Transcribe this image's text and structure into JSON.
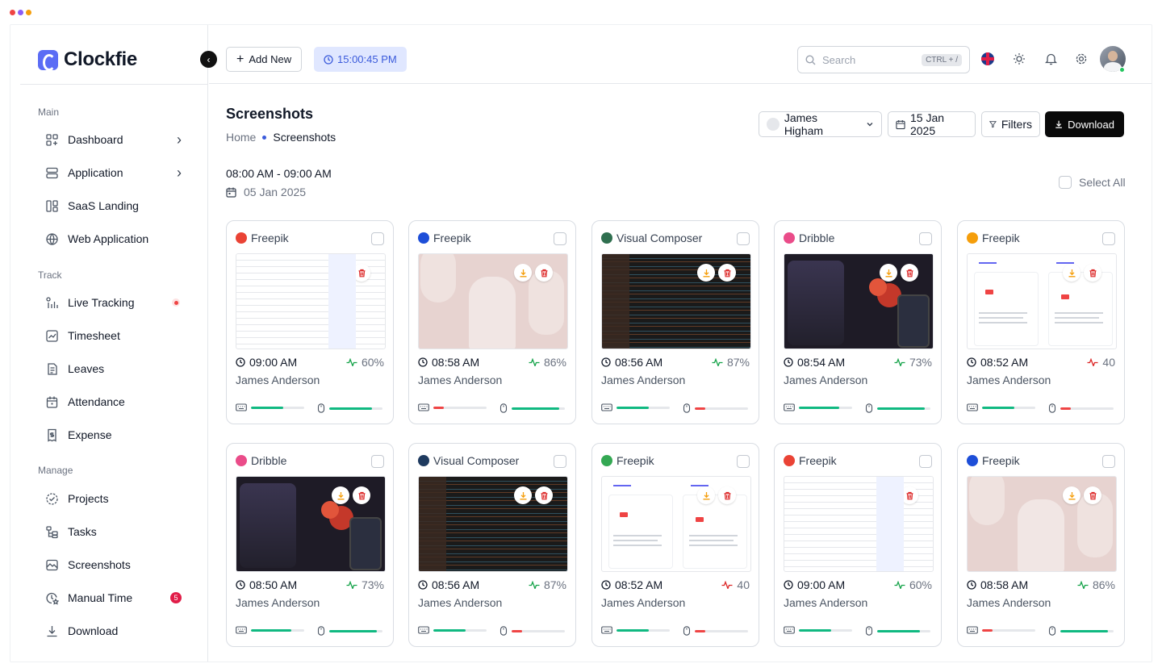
{
  "window_dots": [
    "#ef4444",
    "#8b5cf6",
    "#f59e0b"
  ],
  "brand": {
    "name": "Clockfie",
    "accent": "#5b6cf5"
  },
  "sidebar": {
    "sections": [
      {
        "label": "Main",
        "items": [
          {
            "label": "Dashboard",
            "icon": "grid-icon",
            "chevron": true
          },
          {
            "label": "Application",
            "icon": "layers-icon",
            "chevron": true
          },
          {
            "label": "SaaS Landing",
            "icon": "layout-icon"
          },
          {
            "label": "Web Application",
            "icon": "globe-icon"
          }
        ]
      },
      {
        "label": "Track",
        "items": [
          {
            "label": "Live Tracking",
            "icon": "signal-icon",
            "live": true
          },
          {
            "label": "Timesheet",
            "icon": "chart-icon"
          },
          {
            "label": "Leaves",
            "icon": "document-icon"
          },
          {
            "label": "Attendance",
            "icon": "calendar-icon"
          },
          {
            "label": "Expense",
            "icon": "receipt-icon"
          }
        ]
      },
      {
        "label": "Manage",
        "items": [
          {
            "label": "Projects",
            "icon": "check-circle-icon"
          },
          {
            "label": "Tasks",
            "icon": "tasks-icon"
          },
          {
            "label": "Screenshots",
            "icon": "image-icon"
          },
          {
            "label": "Manual Time",
            "icon": "clock-star-icon",
            "badge": "5"
          },
          {
            "label": "Download",
            "icon": "download-icon"
          }
        ]
      }
    ]
  },
  "header": {
    "add_new": "Add New",
    "clock": "15:00:45 PM",
    "search": {
      "placeholder": "Search",
      "shortcut": "CTRL + /"
    }
  },
  "page": {
    "title": "Screenshots",
    "breadcrumb": {
      "home": "Home",
      "current": "Screenshots"
    },
    "user_filter": "James Higham",
    "date_filter": "15 Jan 2025",
    "filters": "Filters",
    "download": "Download",
    "time_range": "08:00 AM - 09:00 AM",
    "date": "05 Jan 2025",
    "select_all": "Select All"
  },
  "colors": {
    "good": "#16a34a",
    "bad": "#dc2626",
    "bar_good": "#10b981",
    "bar_bad": "#ef4444"
  },
  "cards": [
    {
      "app": "Freepik",
      "app_color": "#ea4335",
      "thumb": "mail",
      "time": "09:00 AM",
      "activity": "60%",
      "good": true,
      "user": "James Anderson",
      "keyboard": 0.6,
      "mouse": 0.8
    },
    {
      "app": "Freepik",
      "app_color": "#1d4ed8",
      "thumb": "hoodie",
      "time": "08:58 AM",
      "activity": "86%",
      "good": true,
      "user": "James Anderson",
      "keyboard": 0.2,
      "mouse": 0.9
    },
    {
      "app": "Visual Composer",
      "app_color": "#2f6f4f",
      "thumb": "code",
      "time": "08:56 AM",
      "activity": "87%",
      "good": true,
      "user": "James Anderson",
      "keyboard": 0.6,
      "mouse": 0.2
    },
    {
      "app": "Dribble",
      "app_color": "#ea4c89",
      "thumb": "dribble",
      "time": "08:54 AM",
      "activity": "73%",
      "good": true,
      "user": "James Anderson",
      "keyboard": 0.75,
      "mouse": 0.9
    },
    {
      "app": "Freepik",
      "app_color": "#f59e0b",
      "thumb": "web",
      "time": "08:52 AM",
      "activity": "40",
      "good": false,
      "user": "James Anderson",
      "keyboard": 0.6,
      "mouse": 0.2
    },
    {
      "app": "Dribble",
      "app_color": "#ea4c89",
      "thumb": "dribble",
      "time": "08:50 AM",
      "activity": "73%",
      "good": true,
      "user": "James Anderson",
      "keyboard": 0.75,
      "mouse": 0.9
    },
    {
      "app": "Visual Composer",
      "app_color": "#1e3a5f",
      "thumb": "code",
      "time": "08:56 AM",
      "activity": "87%",
      "good": true,
      "user": "James Anderson",
      "keyboard": 0.6,
      "mouse": 0.2
    },
    {
      "app": "Freepik",
      "app_color": "#34a853",
      "thumb": "web",
      "time": "08:52 AM",
      "activity": "40",
      "good": false,
      "user": "James Anderson",
      "keyboard": 0.6,
      "mouse": 0.2
    },
    {
      "app": "Freepik",
      "app_color": "#ea4335",
      "thumb": "mail",
      "time": "09:00 AM",
      "activity": "60%",
      "good": true,
      "user": "James Anderson",
      "keyboard": 0.6,
      "mouse": 0.8
    },
    {
      "app": "Freepik",
      "app_color": "#1d4ed8",
      "thumb": "hoodie",
      "time": "08:58 AM",
      "activity": "86%",
      "good": true,
      "user": "James Anderson",
      "keyboard": 0.2,
      "mouse": 0.9
    }
  ]
}
